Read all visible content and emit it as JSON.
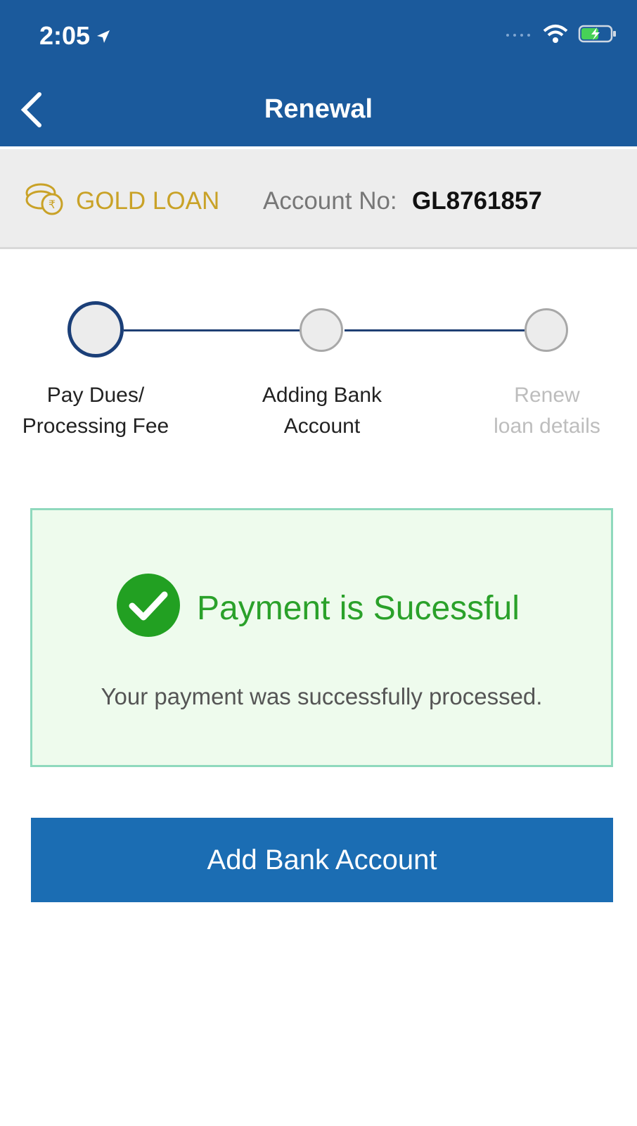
{
  "status_bar": {
    "time": "2:05",
    "icons": [
      "location-arrow-icon",
      "signal-icon",
      "wifi-icon",
      "battery-charging-icon"
    ]
  },
  "header": {
    "title": "Renewal",
    "back_icon": "chevron-left-icon",
    "color": "#1b5a9c"
  },
  "account_bar": {
    "loan_icon": "gold-coins-icon",
    "loan_type": "GOLD LOAN",
    "account_label": "Account No:",
    "account_number": "GL8761857"
  },
  "stepper": {
    "steps": [
      {
        "line1": "Pay Dues/",
        "line2": "Processing Fee",
        "state": "active"
      },
      {
        "line1": "Adding Bank",
        "line2": "Account",
        "state": "pending"
      },
      {
        "line1": "Renew",
        "line2": "loan details",
        "state": "disabled"
      }
    ]
  },
  "success": {
    "icon": "check-circle-icon",
    "title": "Payment is Sucessful",
    "message": "Your payment was successfully processed.",
    "accent_color": "#2aa12a"
  },
  "actions": {
    "add_bank_label": "Add Bank Account"
  }
}
